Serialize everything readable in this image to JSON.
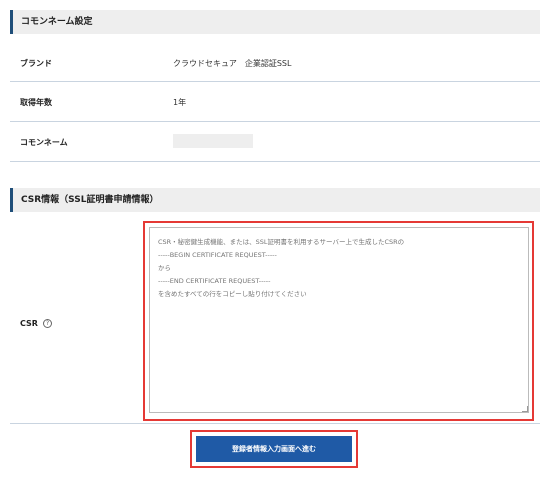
{
  "common_name_section": {
    "title": "コモンネーム設定",
    "rows": [
      {
        "label": "ブランド",
        "value": "クラウドセキュア　企業認証SSL"
      },
      {
        "label": "取得年数",
        "value": "1年"
      },
      {
        "label": "コモンネーム",
        "value": ""
      }
    ]
  },
  "csr_section": {
    "title": "CSR情報（SSL証明書申請情報）",
    "label": "CSR",
    "help_icon": "question-circle-icon",
    "placeholder": "CSR・秘密鍵生成機能、または、SSL証明書を利用するサーバー上で生成したCSRの\n-----BEGIN CERTIFICATE REQUEST-----\nから\n-----END CERTIFICATE REQUEST-----\nを含めたすべての行をコピーし貼り付けてください",
    "value": ""
  },
  "submit": {
    "label": "登録者情報入力画面へ進む"
  },
  "colors": {
    "accent": "#1f5aa6",
    "highlight": "#e53935",
    "header_bg": "#eeeeee"
  }
}
